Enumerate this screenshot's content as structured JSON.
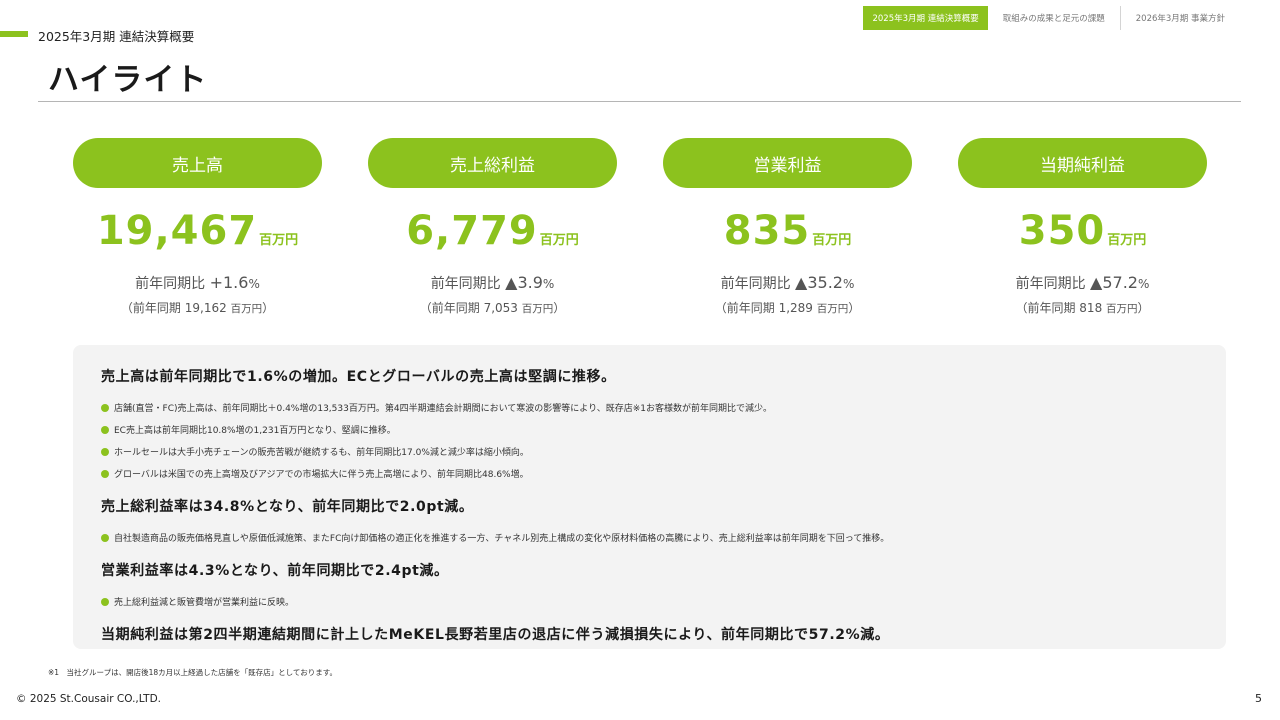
{
  "nav": {
    "tabs": [
      {
        "label": "2025年3月期 連結決算概要",
        "active": true
      },
      {
        "label": "取組みの成果と足元の課題",
        "active": false
      },
      {
        "label": "2026年3月期 事業方針",
        "active": false
      }
    ]
  },
  "header": {
    "section_label": "2025年3月期 連結決算概要",
    "title": "ハイライト"
  },
  "kpis": [
    {
      "label": "売上高",
      "value": "19,467",
      "unit": "百万円",
      "yoy_label": "前年同期比",
      "yoy_value": "+1.6",
      "yoy_unit": "%",
      "prev_label": "（前年同期",
      "prev_value": "19,162",
      "prev_unit": "百万円",
      "prev_close": "）"
    },
    {
      "label": "売上総利益",
      "value": "6,779",
      "unit": "百万円",
      "yoy_label": "前年同期比",
      "yoy_value": "▲3.9",
      "yoy_unit": "%",
      "prev_label": "（前年同期",
      "prev_value": "7,053",
      "prev_unit": "百万円",
      "prev_close": "）"
    },
    {
      "label": "営業利益",
      "value": "835",
      "unit": "百万円",
      "yoy_label": "前年同期比",
      "yoy_value": "▲35.2",
      "yoy_unit": "%",
      "prev_label": "（前年同期",
      "prev_value": "1,289",
      "prev_unit": "百万円",
      "prev_close": "）"
    },
    {
      "label": "当期純利益",
      "value": "350",
      "unit": "百万円",
      "yoy_label": "前年同期比",
      "yoy_value": "▲57.2",
      "yoy_unit": "%",
      "prev_label": "（前年同期",
      "prev_value": "818",
      "prev_unit": "百万円",
      "prev_close": "）"
    }
  ],
  "summary": {
    "sections": [
      {
        "heading": "売上高は前年同期比で1.6%の増加。ECとグローバルの売上高は堅調に推移。",
        "bullets": [
          "店舗(直営・FC)売上高は、前年同期比＋0.4%増の13,533百万円。第4四半期連結会計期間において寒波の影響等により、既存店※1お客様数が前年同期比で減少。",
          "EC売上高は前年同期比10.8%増の1,231百万円となり、堅調に推移。",
          "ホールセールは大手小売チェーンの販売苦戦が継続するも、前年同期比17.0%減と減少率は縮小傾向。",
          "グローバルは米国での売上高増及びアジアでの市場拡大に伴う売上高増により、前年同期比48.6%増。"
        ]
      },
      {
        "heading": "売上総利益率は34.8%となり、前年同期比で2.0pt減。",
        "bullets": [
          "自社製造商品の販売価格見直しや原価低減施策、またFC向け卸価格の適正化を推進する一方、チャネル別売上構成の変化や原材料価格の高騰により、売上総利益率は前年同期を下回って推移。"
        ]
      },
      {
        "heading": "営業利益率は4.3%となり、前年同期比で2.4pt減。",
        "bullets": [
          "売上総利益減と販管費増が営業利益に反映。"
        ]
      },
      {
        "heading": "当期純利益は第2四半期連結期間に計上したMeKEL長野若里店の退店に伴う減損損失により、前年同期比で57.2%減。",
        "bullets": []
      }
    ]
  },
  "footer": {
    "footnote": "※1　当社グループは、開店後18カ月以上経過した店舗を「既存店」としております。",
    "copyright": "© 2025 St.Cousair CO.,LTD.",
    "page_number": "5"
  },
  "colors": {
    "accent": "#8cc21e",
    "summary_bg": "#f3f3f3",
    "text": "#333333"
  }
}
